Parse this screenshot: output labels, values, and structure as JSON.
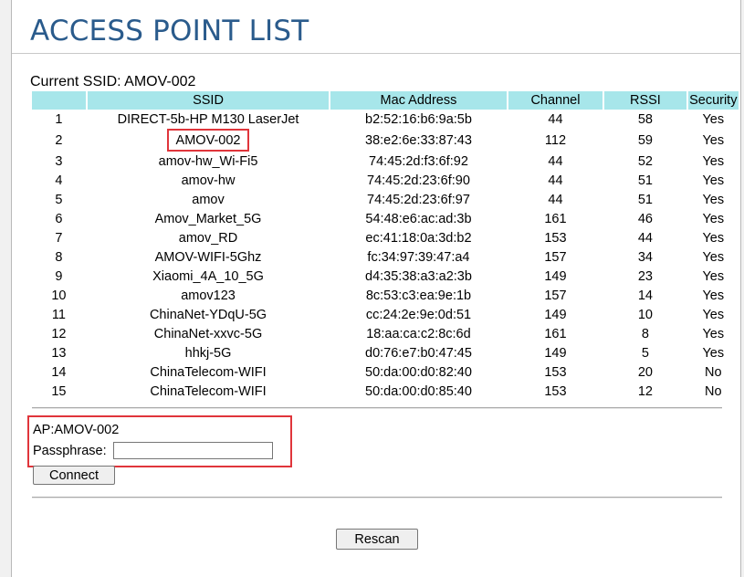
{
  "page": {
    "title": "ACCESS POINT LIST",
    "current_ssid_label": "Current SSID: AMOV-002"
  },
  "table": {
    "headers": [
      "",
      "SSID",
      "Mac Address",
      "Channel",
      "RSSI",
      "Security"
    ],
    "rows": [
      {
        "no": "1",
        "ssid": "DIRECT-5b-HP M130 LaserJet",
        "mac": "b2:52:16:b6:9a:5b",
        "channel": "44",
        "rssi": "58",
        "security": "Yes"
      },
      {
        "no": "2",
        "ssid": "AMOV-002",
        "mac": "38:e2:6e:33:87:43",
        "channel": "112",
        "rssi": "59",
        "security": "Yes",
        "highlighted": true
      },
      {
        "no": "3",
        "ssid": "amov-hw_Wi-Fi5",
        "mac": "74:45:2d:f3:6f:92",
        "channel": "44",
        "rssi": "52",
        "security": "Yes"
      },
      {
        "no": "4",
        "ssid": "amov-hw",
        "mac": "74:45:2d:23:6f:90",
        "channel": "44",
        "rssi": "51",
        "security": "Yes"
      },
      {
        "no": "5",
        "ssid": "amov",
        "mac": "74:45:2d:23:6f:97",
        "channel": "44",
        "rssi": "51",
        "security": "Yes"
      },
      {
        "no": "6",
        "ssid": "Amov_Market_5G",
        "mac": "54:48:e6:ac:ad:3b",
        "channel": "161",
        "rssi": "46",
        "security": "Yes"
      },
      {
        "no": "7",
        "ssid": "amov_RD",
        "mac": "ec:41:18:0a:3d:b2",
        "channel": "153",
        "rssi": "44",
        "security": "Yes"
      },
      {
        "no": "8",
        "ssid": "AMOV-WIFI-5Ghz",
        "mac": "fc:34:97:39:47:a4",
        "channel": "157",
        "rssi": "34",
        "security": "Yes"
      },
      {
        "no": "9",
        "ssid": "Xiaomi_4A_10_5G",
        "mac": "d4:35:38:a3:a2:3b",
        "channel": "149",
        "rssi": "23",
        "security": "Yes"
      },
      {
        "no": "10",
        "ssid": "amov123",
        "mac": "8c:53:c3:ea:9e:1b",
        "channel": "157",
        "rssi": "14",
        "security": "Yes"
      },
      {
        "no": "11",
        "ssid": "ChinaNet-YDqU-5G",
        "mac": "cc:24:2e:9e:0d:51",
        "channel": "149",
        "rssi": "10",
        "security": "Yes"
      },
      {
        "no": "12",
        "ssid": "ChinaNet-xxvc-5G",
        "mac": "18:aa:ca:c2:8c:6d",
        "channel": "161",
        "rssi": "8",
        "security": "Yes"
      },
      {
        "no": "13",
        "ssid": "hhkj-5G",
        "mac": "d0:76:e7:b0:47:45",
        "channel": "149",
        "rssi": "5",
        "security": "Yes"
      },
      {
        "no": "14",
        "ssid": "ChinaTelecom-WIFI",
        "mac": "50:da:00:d0:82:40",
        "channel": "153",
        "rssi": "20",
        "security": "No"
      },
      {
        "no": "15",
        "ssid": "ChinaTelecom-WIFI",
        "mac": "50:da:00:d0:85:40",
        "channel": "153",
        "rssi": "12",
        "security": "No"
      }
    ]
  },
  "connect_form": {
    "ap_label": "AP:AMOV-002",
    "passphrase_label": "Passphrase:",
    "passphrase_value": "",
    "connect_label": "Connect"
  },
  "rescan_label": "Rescan",
  "colors": {
    "title": "#2a5b8c",
    "header_bg": "#a7e6ea",
    "highlight": "#e0353b"
  }
}
